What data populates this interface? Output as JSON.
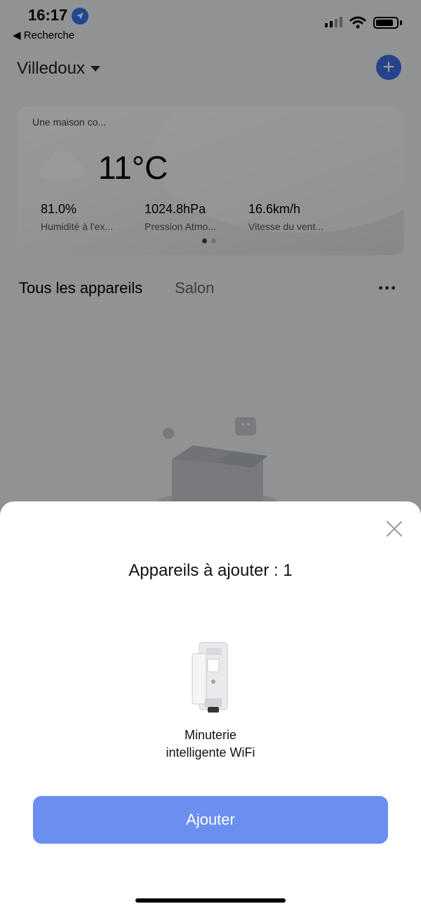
{
  "status_bar": {
    "time": "16:17",
    "back_label": "◀ Recherche"
  },
  "header": {
    "home_name": "Villedoux",
    "add_icon": "plus-icon"
  },
  "weather": {
    "title": "Une maison co...",
    "temperature": "11°C",
    "metrics": [
      {
        "value": "81.0%",
        "label": "Humidité à l'ex..."
      },
      {
        "value": "1024.8hPa",
        "label": "Pression Atmo..."
      },
      {
        "value": "16.6km/h",
        "label": "Vitesse du vent..."
      }
    ]
  },
  "tabs": {
    "all": "Tous les appareils",
    "salon": "Salon"
  },
  "sheet": {
    "title": "Appareils à ajouter : 1",
    "device_line1": "Minuterie",
    "device_line2": "intelligente WiFi",
    "add_button": "Ajouter"
  },
  "colors": {
    "accent": "#3e6fe8",
    "button": "#6b8ff0",
    "overlay": "rgba(0,0,0,0.4)"
  }
}
